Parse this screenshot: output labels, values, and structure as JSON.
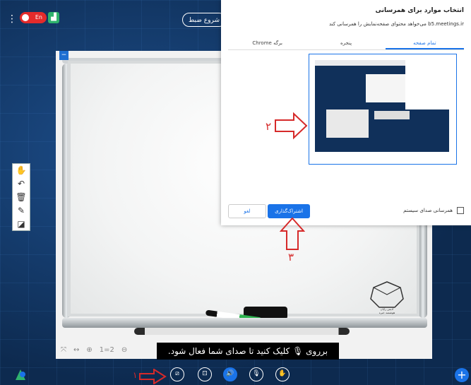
{
  "topbar": {
    "kebab": "⋮",
    "lang_label": "En",
    "chart_icon": "▟",
    "record_label": "شروع ضبط"
  },
  "whiteboard": {
    "corner_btn": "−",
    "logo_text_1": "آدیس رایان",
    "logo_text_2": "هوشمند خبره"
  },
  "zoom": {
    "fit": "⤧",
    "width": "↔",
    "zoom_in": "⊕",
    "ratio": "1=2",
    "zoom_out": "⊖"
  },
  "tools": [
    "✋",
    "↶",
    "🗑",
    "✎",
    "◪"
  ],
  "dialog": {
    "title": "انتخاب موارد برای همرسانی",
    "subtitle": "b5.meetings.ir می‌خواهد محتوای صفحه‌نمایش را همرسانی کند",
    "tabs": [
      "تمام صفحه",
      "پنجره",
      "برگه Chrome"
    ],
    "checkbox_label": "همرسانی صدای سیستم",
    "share_label": "اشتراک‌گذاری",
    "cancel_label": "لغو"
  },
  "annotations": {
    "num1": "۱",
    "num2": "۲",
    "num3": "۳"
  },
  "tooltip": {
    "text": "برروی 🎙 کلیک کنید تا صدای شما فعال شود."
  },
  "bottom": {
    "buttons": [
      "⧄",
      "⊡",
      "🔊",
      "🎙",
      "✋"
    ],
    "plus": "+"
  },
  "colors": {
    "background": "#0d2a4f",
    "accent": "#1a73e8",
    "annotation": "#d62a2a",
    "record": "#e32b2b"
  }
}
